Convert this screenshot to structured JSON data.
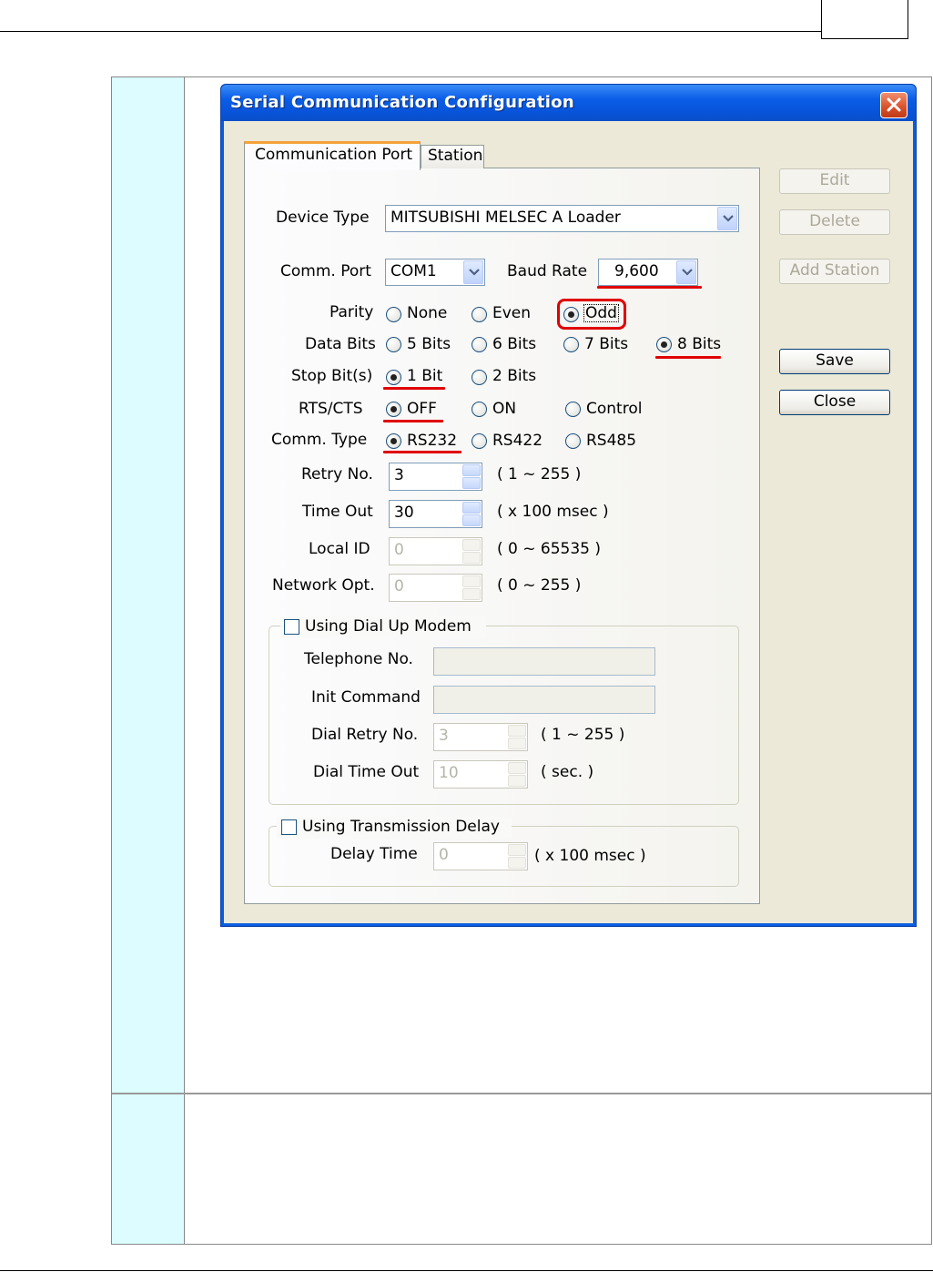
{
  "window": {
    "title": "Serial Communication Configuration",
    "tabs": [
      "Communication Port",
      "Station"
    ]
  },
  "form": {
    "device_type": {
      "label": "Device Type",
      "value": "MITSUBISHI MELSEC A Loader"
    },
    "comm_port": {
      "label": "Comm. Port",
      "value": "COM1"
    },
    "baud_rate": {
      "label": "Baud Rate",
      "value": "9,600"
    },
    "parity": {
      "label": "Parity",
      "options": [
        "None",
        "Even",
        "Odd"
      ],
      "selected": "Odd"
    },
    "data_bits": {
      "label": "Data Bits",
      "options": [
        "5 Bits",
        "6 Bits",
        "7 Bits",
        "8 Bits"
      ],
      "selected": "8 Bits"
    },
    "stop_bits": {
      "label": "Stop Bit(s)",
      "options": [
        "1 Bit",
        "2 Bits"
      ],
      "selected": "1 Bit"
    },
    "rts_cts": {
      "label": "RTS/CTS",
      "options": [
        "OFF",
        "ON",
        "Control"
      ],
      "selected": "OFF"
    },
    "comm_type": {
      "label": "Comm. Type",
      "options": [
        "RS232",
        "RS422",
        "RS485"
      ],
      "selected": "RS232"
    },
    "retry_no": {
      "label": "Retry No.",
      "value": "3",
      "range": "( 1 ~ 255 )"
    },
    "time_out": {
      "label": "Time Out",
      "value": "30",
      "range": "( x 100 msec )"
    },
    "local_id": {
      "label": "Local ID",
      "value": "0",
      "range": "( 0 ~ 65535 )"
    },
    "network_opt": {
      "label": "Network Opt.",
      "value": "0",
      "range": "( 0 ~ 255 )"
    }
  },
  "dialup": {
    "label": "Using Dial Up Modem",
    "telephone_label": "Telephone No.",
    "init_label": "Init Command",
    "dial_retry": {
      "label": "Dial Retry No.",
      "value": "3",
      "range": "( 1 ~ 255 )"
    },
    "dial_timeout": {
      "label": "Dial Time Out",
      "value": "10",
      "range": "( sec. )"
    }
  },
  "delay": {
    "label": "Using Transmission Delay",
    "delay_time": {
      "label": "Delay Time",
      "value": "0",
      "range": "( x 100 msec )"
    }
  },
  "buttons": {
    "edit": "Edit",
    "delete": "Delete",
    "add_station": "Add Station",
    "save": "Save",
    "close": "Close"
  },
  "colors": {
    "highlight": "#e00000",
    "titlebar": "#0a5de6",
    "doc_sidebar": "#dcfcff"
  }
}
